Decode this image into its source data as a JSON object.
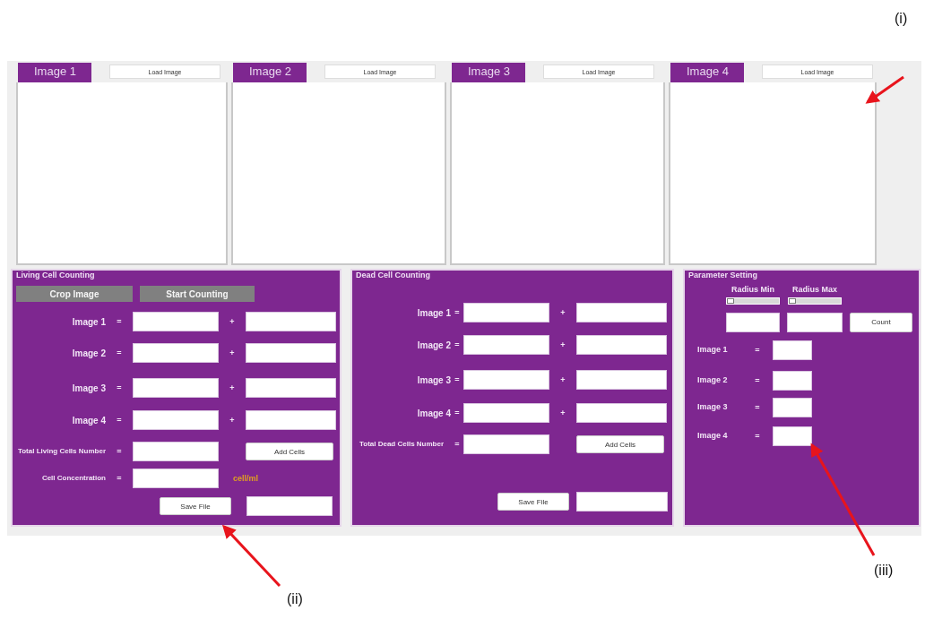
{
  "image_panels": [
    {
      "tab": "Image 1",
      "load_button": "Load Image"
    },
    {
      "tab": "Image 2",
      "load_button": "Load Image"
    },
    {
      "tab": "Image 3",
      "load_button": "Load Image"
    },
    {
      "tab": "Image 4",
      "load_button": "Load Image"
    }
  ],
  "living_cell_counting": {
    "title": "Living Cell Counting",
    "buttons": [
      "Crop Image",
      "Start Counting"
    ],
    "rows": [
      {
        "label": "Image 1",
        "equals": "=",
        "plus": "+"
      },
      {
        "label": "Image 2",
        "equals": "=",
        "plus": "+"
      },
      {
        "label": "Image 3",
        "equals": "=",
        "plus": "+"
      },
      {
        "label": "Image 4",
        "equals": "=",
        "plus": "+"
      }
    ],
    "total": {
      "label": "Total Living Cells Number",
      "equals": "=",
      "button": "Add Cells"
    },
    "concentration": {
      "label": "Cell Concentration",
      "equals": "=",
      "unit": "cell/ml"
    },
    "save_button": "Save File"
  },
  "dead_cell_counting": {
    "title": "Dead Cell Counting",
    "rows": [
      {
        "label": "Image 1",
        "equals": "=",
        "plus": "+"
      },
      {
        "label": "Image 2",
        "equals": "=",
        "plus": "+"
      },
      {
        "label": "Image 3",
        "equals": "=",
        "plus": "+"
      },
      {
        "label": "Image 4",
        "equals": "=",
        "plus": "+"
      }
    ],
    "total": {
      "label": "Total Dead Cells Number",
      "equals": "=",
      "button": "Add Cells"
    },
    "save_button": "Save File"
  },
  "parameter_setting": {
    "title": "Parameter Setting",
    "radius_min": {
      "label": "Radius Min",
      "level": 0
    },
    "radius_max": {
      "label": "Radius Max",
      "level": 0
    },
    "count_button": "Count",
    "rows": [
      {
        "label": "Image 1",
        "equals": "="
      },
      {
        "label": "Image 2",
        "equals": "="
      },
      {
        "label": "Image 3",
        "equals": "="
      },
      {
        "label": "Image 4",
        "equals": "="
      }
    ]
  },
  "annotations": [
    "(i)",
    "(ii)",
    "(iii)"
  ]
}
